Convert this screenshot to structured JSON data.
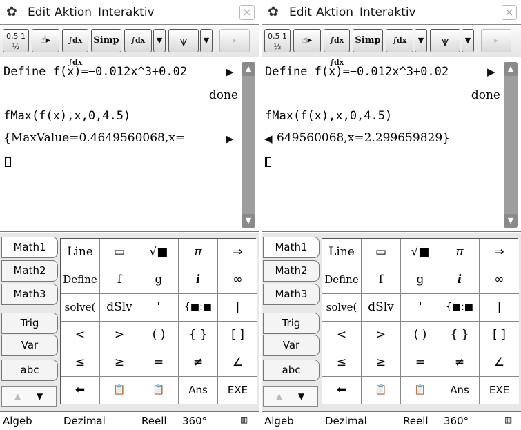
{
  "menu": {
    "edit": "Edit",
    "action": "Aktion",
    "interactive": "Interaktiv",
    "close": "×"
  },
  "toolbar": {
    "frac_label": "0,5 1 ½",
    "drag_label": "☝▸",
    "integral_label": "∫dx ∫dx",
    "simp_label": "Simp",
    "integral2_label": "∫dx",
    "dropdown1": "▼",
    "graph_label": "⩛",
    "dropdown2": "▼",
    "more": "▸"
  },
  "left": {
    "line1": "Define f(x)=−0.012x^3+0.02",
    "line1_result": "done",
    "line2": "fMax(f(x),x,0,4.5)",
    "line3": "{MaxValue=0.4649560068,x="
  },
  "right": {
    "line1": "Define f(x)=−0.012x^3+0.02",
    "line1_result": "done",
    "line2": "fMax(f(x),x,0,4.5)",
    "line3": "649560068,x=2.299659829}"
  },
  "tabs": [
    "Math1",
    "Math2",
    "Math3",
    "Trig",
    "Var",
    "abc"
  ],
  "keys": [
    [
      "Line",
      "▭",
      "√■",
      "π",
      "⇒"
    ],
    [
      "Define",
      "f",
      "g",
      "i",
      "∞"
    ],
    [
      "solve(",
      "dSlv",
      "'",
      "{■:■",
      "|"
    ],
    [
      "<",
      ">",
      "( )",
      "{ }",
      "[ ]"
    ],
    [
      "≤",
      "≥",
      "=",
      "≠",
      "∠"
    ],
    [
      "⬅",
      "📋",
      "📋",
      "Ans",
      "EXE"
    ]
  ],
  "scroll_arrows": {
    "left": "▲",
    "right": "▼"
  },
  "status": {
    "mode": "Algeb",
    "number": "Dezimal",
    "domain": "Reell",
    "angle": "360°"
  }
}
